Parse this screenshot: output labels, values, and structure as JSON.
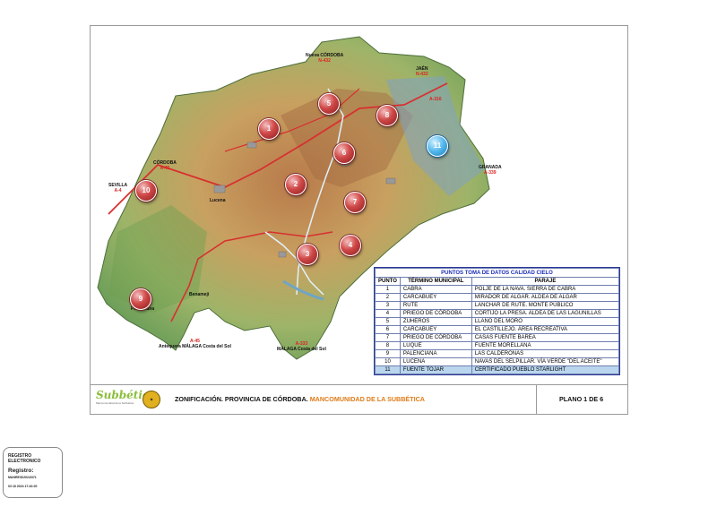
{
  "map": {
    "road_labels": [
      {
        "id": "cordoba_n",
        "text": "Nueva CÓRDOBA",
        "road": "N-432"
      },
      {
        "id": "jaen",
        "text": "JAÉN",
        "road": "N-432"
      },
      {
        "id": "a316",
        "text": "",
        "road": "A-316"
      },
      {
        "id": "cordoba_w",
        "text": "CÓRDOBA",
        "road": "A-45"
      },
      {
        "id": "sevilla",
        "text": "SEVILLA",
        "road": "A-4"
      },
      {
        "id": "granada",
        "text": "GRANADA",
        "road": "A-339"
      },
      {
        "id": "malaga_w",
        "text": "Antequera MÁLAGA",
        "road": "A-45"
      },
      {
        "id": "malaga_e",
        "text": "MÁLAGA",
        "road": "A-333"
      },
      {
        "id": "costa_w",
        "text": "Costa del Sol",
        "road": ""
      },
      {
        "id": "costa_e",
        "text": "Costa del Sol",
        "road": ""
      }
    ],
    "town_labels": [
      "Lucena",
      "Palenciana",
      "Benamejí"
    ],
    "markers": [
      {
        "num": "1",
        "color": "red"
      },
      {
        "num": "2",
        "color": "red"
      },
      {
        "num": "3",
        "color": "red"
      },
      {
        "num": "4",
        "color": "red"
      },
      {
        "num": "5",
        "color": "red"
      },
      {
        "num": "6",
        "color": "red"
      },
      {
        "num": "7",
        "color": "red"
      },
      {
        "num": "8",
        "color": "red"
      },
      {
        "num": "9",
        "color": "red"
      },
      {
        "num": "10",
        "color": "red"
      },
      {
        "num": "11",
        "color": "blue"
      }
    ]
  },
  "legend": {
    "title": "PUNTOS TOMA DE DATOS CALIDAD CIELO",
    "headers": [
      "PUNTO",
      "TÉRMINO MUNICIPAL",
      "PARAJE"
    ],
    "rows": [
      [
        "1",
        "CABRA",
        "POLJE DE LA NAVA. SIERRA DE CABRA"
      ],
      [
        "2",
        "CARCABUEY",
        "MIRADOR DE ALGAR. ALDEA DE ALGAR"
      ],
      [
        "3",
        "RUTE",
        "LANCHAR DE RUTE. MONTE PÚBLICO"
      ],
      [
        "4",
        "PRIEGO DE CÓRDOBA",
        "CORTIJO LA PRESA. ALDEA DE LAS LAGUNILLAS"
      ],
      [
        "5",
        "ZUHEROS",
        "LLANO DEL MORO"
      ],
      [
        "6",
        "CARCABUEY",
        "EL CASTILLEJO. ÁREA RECREATIVA"
      ],
      [
        "7",
        "PRIEGO DE CÓRDOBA",
        "CASAS FUENTE BAREA"
      ],
      [
        "8",
        "LUQUE",
        "FUENTE MORELLANA"
      ],
      [
        "9",
        "PALENCIANA",
        "LAS CALDERONAS"
      ],
      [
        "10",
        "LUCENA",
        "NAVAS DEL SELPILLAR. VÍA VERDE \"DEL ACEITE\""
      ],
      [
        "11",
        "FUENTE TOJAR",
        "CERTIFICADO PUEBLO STARLIGHT"
      ]
    ],
    "highlight_row": 11
  },
  "footer": {
    "logo_text": "Subbética",
    "logo_sub": "Mancomunidad de la Subbética",
    "title_main": "ZONIFICACIÓN. PROVINCIA DE CÓRDOBA. ",
    "title_org": "MANCOMUNIDAD DE LA SUBBÉTICA",
    "plano": "PLANO 1 DE 6"
  },
  "stamp": {
    "line1": "REGISTRO",
    "line2": "ELECTRONICO",
    "label": "Registro:",
    "number": "MANRE/S/2024/371",
    "datetime": "03 18 2024 17:40:20"
  },
  "colors": {
    "marker_red": "#c93a3a",
    "marker_blue": "#4fb3e8",
    "legend_title": "#1f2fb8",
    "org_orange": "#e07b17",
    "highlight": "#b9d6ee"
  }
}
